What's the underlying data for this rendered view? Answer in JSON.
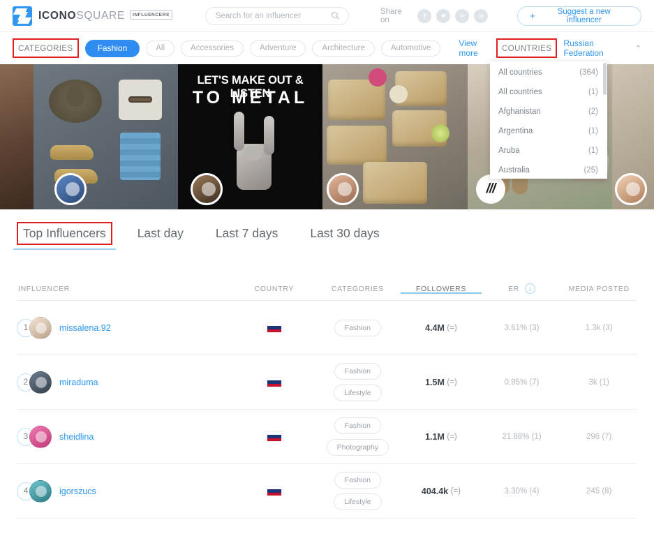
{
  "header": {
    "logo": {
      "primary": "ICONO",
      "secondary": "SQUARE",
      "badge": "INFLUENCERS"
    },
    "search": {
      "placeholder": "Search for an influencer",
      "value": ""
    },
    "share_label": "Share on",
    "social": [
      {
        "name": "facebook-icon",
        "glyph": "f"
      },
      {
        "name": "twitter-icon",
        "glyph": "t"
      },
      {
        "name": "google-plus-icon",
        "glyph": "g"
      },
      {
        "name": "linkedin-icon",
        "glyph": "in"
      }
    ],
    "suggest_button": {
      "plus": "+",
      "label": "Suggest a new influencer"
    }
  },
  "filters": {
    "categories_label": "CATEGORIES",
    "category_pills": [
      {
        "label": "Fashion",
        "active": true
      },
      {
        "label": "All",
        "active": false
      },
      {
        "label": "Accessories",
        "active": false
      },
      {
        "label": "Adventure",
        "active": false
      },
      {
        "label": "Architecture",
        "active": false
      },
      {
        "label": "Automotive",
        "active": false
      }
    ],
    "view_more": "View more",
    "countries_label": "COUNTRIES",
    "country_selected": "Russian Federation",
    "caret": "⌃",
    "country_dropdown": [
      {
        "label": "All countries",
        "count": "(364)"
      },
      {
        "label": "All countries",
        "count": "(1)"
      },
      {
        "label": "Afghanistan",
        "count": "(2)"
      },
      {
        "label": "Argentina",
        "count": "(1)"
      },
      {
        "label": "Aruba",
        "count": "(1)"
      },
      {
        "label": "Australia",
        "count": "(25)"
      }
    ]
  },
  "banner": {
    "poster_line1": "LET'S MAKE OUT & LISTEN",
    "poster_line2": "TO METAL",
    "badge_mark": "///"
  },
  "tabs": [
    {
      "label": "Top Influencers",
      "active": true
    },
    {
      "label": "Last day",
      "active": false
    },
    {
      "label": "Last 7 days",
      "active": false
    },
    {
      "label": "Last 30 days",
      "active": false
    }
  ],
  "table": {
    "columns": {
      "influencer": "INFLUENCER",
      "country": "COUNTRY",
      "categories": "CATEGORIES",
      "followers": "FOLLOWERS",
      "er": "ER",
      "er_info": "i",
      "media": "MEDIA POSTED"
    },
    "rows": [
      {
        "rank": "1",
        "username": "missalena.92",
        "country": "Russian Federation",
        "categories": [
          "Fashion"
        ],
        "followers": "4.4M",
        "followers_trend": "(=)",
        "er": "3.61% (3)",
        "media": "1.3k (3)"
      },
      {
        "rank": "2",
        "username": "miraduma",
        "country": "Russian Federation",
        "categories": [
          "Fashion",
          "Lifestyle"
        ],
        "followers": "1.5M",
        "followers_trend": "(=)",
        "er": "0.95% (7)",
        "media": "3k (1)"
      },
      {
        "rank": "3",
        "username": "sheidlina",
        "country": "Russian Federation",
        "categories": [
          "Fashion",
          "Photography"
        ],
        "followers": "1.1M",
        "followers_trend": "(=)",
        "er": "21.88% (1)",
        "media": "296 (7)"
      },
      {
        "rank": "4",
        "username": "igorszucs",
        "country": "Russian Federation",
        "categories": [
          "Fashion",
          "Lifestyle"
        ],
        "followers": "404.4k",
        "followers_trend": "(=)",
        "er": "3.30% (4)",
        "media": "245 (8)"
      }
    ]
  },
  "colors": {
    "accent": "#2f97f0",
    "pill_active": "#2f8cf0",
    "highlight_box": "#e02020",
    "muted": "#9aa2ab"
  }
}
